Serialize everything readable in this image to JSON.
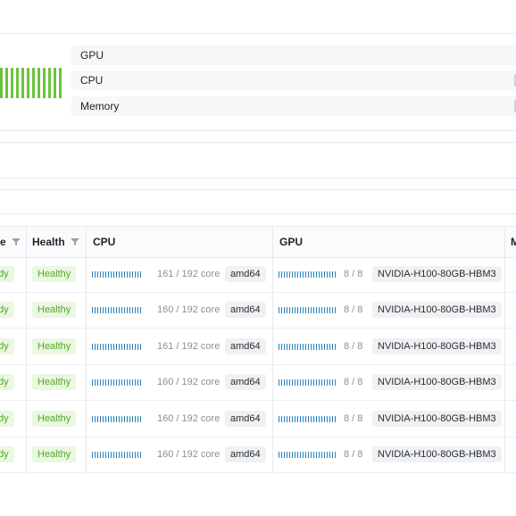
{
  "summary": {
    "metrics": [
      {
        "label": "GPU"
      },
      {
        "label": "CPU"
      },
      {
        "label": "Memory"
      }
    ]
  },
  "table": {
    "headers": {
      "status_partial": "e",
      "health": "Health",
      "cpu": "CPU",
      "gpu": "GPU",
      "memory_partial": "M"
    },
    "rows": [
      {
        "status": "dy",
        "health": "Healthy",
        "cpu_used": 161,
        "cpu_total": 192,
        "cpu_text": "161 / 192 core",
        "arch": "amd64",
        "gpu_used": 8,
        "gpu_total": 8,
        "gpu_text": "8 / 8",
        "gpu_model": "NVIDIA-H100-80GB-HBM3"
      },
      {
        "status": "dy",
        "health": "Healthy",
        "cpu_used": 160,
        "cpu_total": 192,
        "cpu_text": "160 / 192 core",
        "arch": "amd64",
        "gpu_used": 8,
        "gpu_total": 8,
        "gpu_text": "8 / 8",
        "gpu_model": "NVIDIA-H100-80GB-HBM3"
      },
      {
        "status": "dy",
        "health": "Healthy",
        "cpu_used": 161,
        "cpu_total": 192,
        "cpu_text": "161 / 192 core",
        "arch": "amd64",
        "gpu_used": 8,
        "gpu_total": 8,
        "gpu_text": "8 / 8",
        "gpu_model": "NVIDIA-H100-80GB-HBM3"
      },
      {
        "status": "dy",
        "health": "Healthy",
        "cpu_used": 160,
        "cpu_total": 192,
        "cpu_text": "160 / 192 core",
        "arch": "amd64",
        "gpu_used": 8,
        "gpu_total": 8,
        "gpu_text": "8 / 8",
        "gpu_model": "NVIDIA-H100-80GB-HBM3"
      },
      {
        "status": "dy",
        "health": "Healthy",
        "cpu_used": 160,
        "cpu_total": 192,
        "cpu_text": "160 / 192 core",
        "arch": "amd64",
        "gpu_used": 8,
        "gpu_total": 8,
        "gpu_text": "8 / 8",
        "gpu_model": "NVIDIA-H100-80GB-HBM3"
      },
      {
        "status": "dy",
        "health": "Healthy",
        "cpu_used": 160,
        "cpu_total": 192,
        "cpu_text": "160 / 192 core",
        "arch": "amd64",
        "gpu_used": 8,
        "gpu_total": 8,
        "gpu_text": "8 / 8",
        "gpu_model": "NVIDIA-H100-80GB-HBM3"
      }
    ]
  },
  "colors": {
    "healthy_text": "#56a92a",
    "healthy_bg": "#eaf7e1",
    "usage_bar": "#6ac43a",
    "mini_bar": "#2b7fb8"
  }
}
